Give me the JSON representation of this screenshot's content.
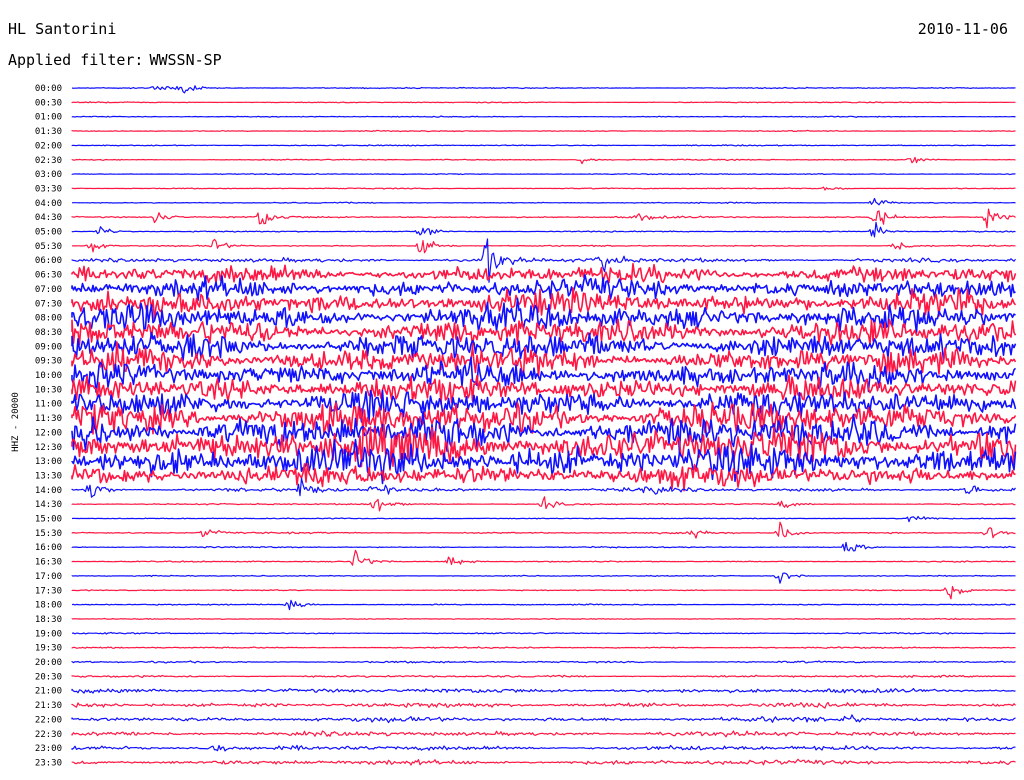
{
  "header": {
    "station": "HL Santorini",
    "date": "2010-11-06",
    "filter_label": "Applied filter:",
    "filter_value": "WWSSN-SP"
  },
  "channel_label": "HHZ - 20000",
  "colors": {
    "even_trace": "#1010ff",
    "odd_trace": "#ff1744"
  },
  "chart_data": {
    "type": "line",
    "title": "HL Santorini",
    "ylabel": "HHZ - 20000",
    "rows": [
      {
        "label": "00:00",
        "level": 0.4,
        "events": [
          [
            0.09,
            5
          ],
          [
            0.115,
            7
          ]
        ]
      },
      {
        "label": "00:30",
        "level": 0.35,
        "events": []
      },
      {
        "label": "01:00",
        "level": 0.35,
        "events": []
      },
      {
        "label": "01:30",
        "level": 0.35,
        "events": []
      },
      {
        "label": "02:00",
        "level": 0.4,
        "events": []
      },
      {
        "label": "02:30",
        "level": 0.4,
        "events": [
          [
            0.54,
            3
          ],
          [
            0.89,
            4
          ]
        ]
      },
      {
        "label": "03:00",
        "level": 0.35,
        "events": []
      },
      {
        "label": "03:30",
        "level": 0.35,
        "events": [
          [
            0.8,
            3
          ]
        ]
      },
      {
        "label": "04:00",
        "level": 0.35,
        "events": [
          [
            0.85,
            5
          ]
        ]
      },
      {
        "label": "04:30",
        "level": 0.6,
        "events": [
          [
            0.09,
            6
          ],
          [
            0.2,
            10
          ],
          [
            0.6,
            4
          ],
          [
            0.85,
            11
          ],
          [
            0.97,
            7
          ]
        ]
      },
      {
        "label": "05:00",
        "level": 0.4,
        "events": [
          [
            0.03,
            5
          ],
          [
            0.37,
            5
          ],
          [
            0.85,
            9
          ]
        ]
      },
      {
        "label": "05:30",
        "level": 0.4,
        "events": [
          [
            0.02,
            5
          ],
          [
            0.15,
            6
          ],
          [
            0.37,
            16
          ],
          [
            0.87,
            7
          ]
        ]
      },
      {
        "label": "06:00",
        "level": 1.4,
        "events": [
          [
            0.44,
            22
          ],
          [
            0.56,
            16
          ]
        ]
      },
      {
        "label": "06:30",
        "level": 6,
        "events": []
      },
      {
        "label": "07:00",
        "level": 7,
        "events": []
      },
      {
        "label": "07:30",
        "level": 8,
        "events": []
      },
      {
        "label": "08:00",
        "level": 9,
        "events": []
      },
      {
        "label": "08:30",
        "level": 9,
        "events": []
      },
      {
        "label": "09:00",
        "level": 9,
        "events": []
      },
      {
        "label": "09:30",
        "level": 9,
        "events": []
      },
      {
        "label": "10:00",
        "level": 9,
        "events": []
      },
      {
        "label": "10:30",
        "level": 9,
        "events": []
      },
      {
        "label": "11:00",
        "level": 10,
        "events": []
      },
      {
        "label": "11:30",
        "level": 11,
        "events": []
      },
      {
        "label": "12:00",
        "level": 12,
        "events": []
      },
      {
        "label": "12:30",
        "level": 13,
        "events": []
      },
      {
        "label": "13:00",
        "level": 12,
        "events": []
      },
      {
        "label": "13:30",
        "level": 8,
        "events": []
      },
      {
        "label": "14:00",
        "level": 1.2,
        "events": [
          [
            0.02,
            8
          ],
          [
            0.24,
            10
          ],
          [
            0.32,
            8
          ],
          [
            0.61,
            5
          ],
          [
            0.95,
            6
          ]
        ]
      },
      {
        "label": "14:30",
        "level": 0.5,
        "events": [
          [
            0.32,
            8
          ],
          [
            0.5,
            5
          ],
          [
            0.75,
            4
          ]
        ]
      },
      {
        "label": "15:00",
        "level": 0.35,
        "events": [
          [
            0.89,
            6
          ]
        ]
      },
      {
        "label": "15:30",
        "level": 0.5,
        "events": [
          [
            0.14,
            5
          ],
          [
            0.66,
            7
          ],
          [
            0.75,
            10
          ],
          [
            0.97,
            7
          ]
        ]
      },
      {
        "label": "16:00",
        "level": 0.4,
        "events": [
          [
            0.82,
            9
          ]
        ]
      },
      {
        "label": "16:30",
        "level": 0.4,
        "events": [
          [
            0.3,
            10
          ],
          [
            0.4,
            8
          ]
        ]
      },
      {
        "label": "17:00",
        "level": 0.35,
        "events": [
          [
            0.75,
            6
          ]
        ]
      },
      {
        "label": "17:30",
        "level": 0.35,
        "events": [
          [
            0.93,
            8
          ]
        ]
      },
      {
        "label": "18:00",
        "level": 0.4,
        "events": [
          [
            0.23,
            8
          ]
        ]
      },
      {
        "label": "18:30",
        "level": 0.35,
        "events": []
      },
      {
        "label": "19:00",
        "level": 0.45,
        "events": []
      },
      {
        "label": "19:30",
        "level": 0.5,
        "events": []
      },
      {
        "label": "20:00",
        "level": 0.6,
        "events": []
      },
      {
        "label": "20:30",
        "level": 0.7,
        "events": []
      },
      {
        "label": "21:00",
        "level": 1.5,
        "events": []
      },
      {
        "label": "21:30",
        "level": 1.6,
        "events": []
      },
      {
        "label": "22:00",
        "level": 1.6,
        "events": [
          [
            0.82,
            5
          ]
        ]
      },
      {
        "label": "22:30",
        "level": 1.6,
        "events": []
      },
      {
        "label": "23:00",
        "level": 1.6,
        "events": [
          [
            0.15,
            4
          ]
        ]
      },
      {
        "label": "23:30",
        "level": 1.7,
        "events": []
      }
    ]
  }
}
